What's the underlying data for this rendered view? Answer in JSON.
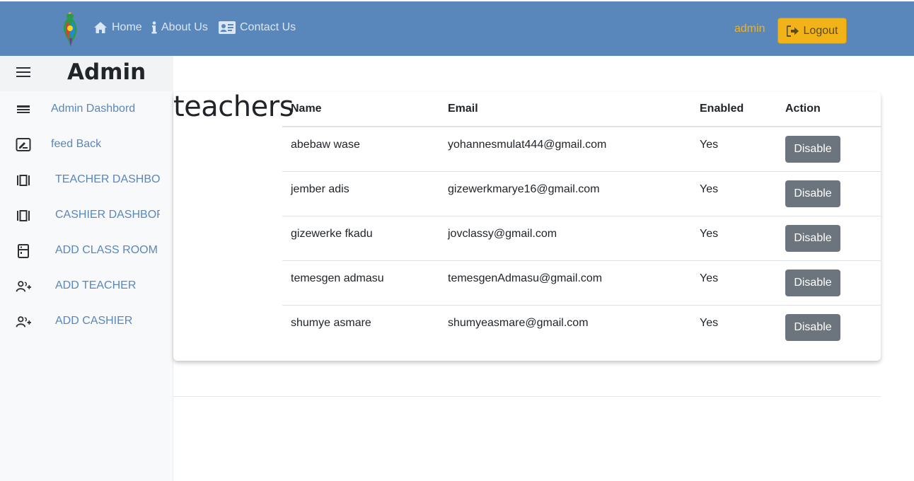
{
  "navbar": {
    "links": [
      {
        "label": "Home",
        "icon": "home-icon"
      },
      {
        "label": "About Us",
        "icon": "info-icon"
      },
      {
        "label": "Contact Us",
        "icon": "contact-card-icon"
      }
    ],
    "username": "admin",
    "logout_label": "Logout",
    "colors": {
      "bar": "#5a87bb",
      "logout": "#f2b318",
      "username": "#f0b11c"
    }
  },
  "sidebar": {
    "title": "Admin",
    "items": [
      {
        "label": "Admin Dashbord",
        "icon": "list-icon"
      },
      {
        "label": "feed Back",
        "icon": "edit-note-icon"
      },
      {
        "label": "TEACHER DASHBORD",
        "icon": "dashboard-icon"
      },
      {
        "label": "CASHIER DASHBORD",
        "icon": "dashboard-icon"
      },
      {
        "label": "ADD CLASS ROOM",
        "icon": "door-icon"
      },
      {
        "label": "ADD TEACHER",
        "icon": "add-user-icon"
      },
      {
        "label": "ADD CASHIER",
        "icon": "add-user-icon"
      }
    ]
  },
  "main": {
    "heading": "teachers",
    "table": {
      "columns": [
        "Name",
        "Email",
        "Enabled",
        "Action"
      ],
      "rows": [
        {
          "name": "abebaw wase",
          "email": "yohannesmulat444@gmail.com",
          "enabled": "Yes",
          "action": "Disable"
        },
        {
          "name": "jember adis",
          "email": "gizewerkmarye16@gmail.com",
          "enabled": "Yes",
          "action": "Disable"
        },
        {
          "name": "gizewerke fkadu",
          "email": "jovclassy@gmail.com",
          "enabled": "Yes",
          "action": "Disable"
        },
        {
          "name": "temesgen admasu",
          "email": "temesgenAdmasu@gmail.com",
          "enabled": "Yes",
          "action": "Disable"
        },
        {
          "name": "shumye asmare",
          "email": "shumyeasmare@gmail.com",
          "enabled": "Yes",
          "action": "Disable"
        }
      ]
    }
  }
}
